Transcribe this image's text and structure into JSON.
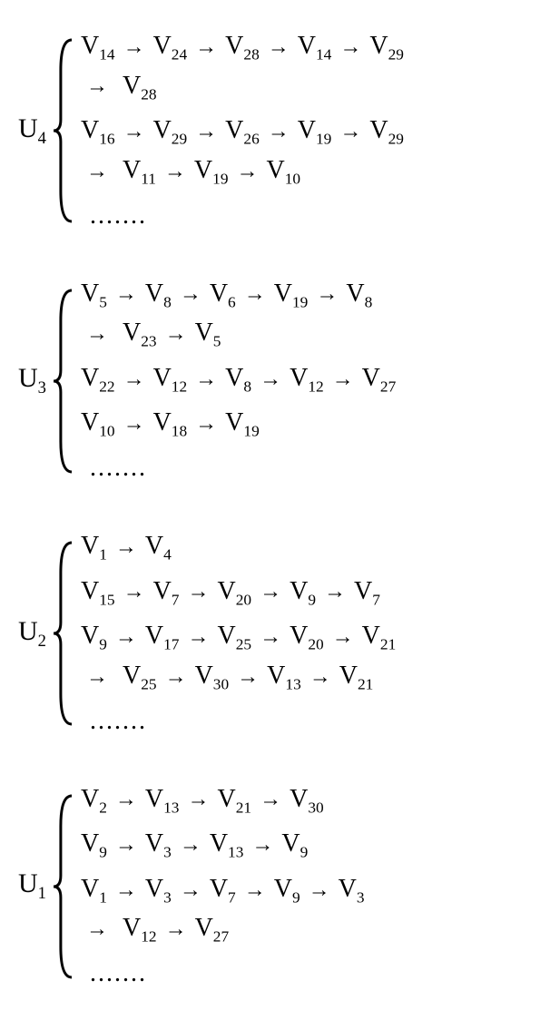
{
  "arrow": "→",
  "dots": ".......",
  "groups": [
    {
      "label_main": "U",
      "label_sub": "4",
      "rows": [
        {
          "indices": [
            14,
            24,
            28,
            14,
            29,
            28
          ],
          "break_after": 5
        },
        {
          "indices": [
            16,
            29,
            26,
            19,
            29,
            11,
            19,
            10
          ],
          "break_after": 5
        }
      ]
    },
    {
      "label_main": "U",
      "label_sub": "3",
      "rows": [
        {
          "indices": [
            5,
            8,
            6,
            19,
            8,
            23,
            5
          ],
          "break_after": 5
        },
        {
          "indices": [
            22,
            12,
            8,
            12,
            27
          ],
          "break_after": 99
        },
        {
          "indices": [
            10,
            18,
            19
          ],
          "break_after": 99
        }
      ]
    },
    {
      "label_main": "U",
      "label_sub": "2",
      "rows": [
        {
          "indices": [
            1,
            4
          ],
          "break_after": 99
        },
        {
          "indices": [
            15,
            7,
            20,
            9,
            7
          ],
          "break_after": 99
        },
        {
          "indices": [
            9,
            17,
            25,
            20,
            21,
            25,
            30,
            13,
            21
          ],
          "break_after": 5
        }
      ]
    },
    {
      "label_main": "U",
      "label_sub": "1",
      "rows": [
        {
          "indices": [
            2,
            13,
            21,
            30
          ],
          "break_after": 99
        },
        {
          "indices": [
            9,
            3,
            13,
            9
          ],
          "break_after": 99
        },
        {
          "indices": [
            1,
            3,
            7,
            9,
            3,
            12,
            27
          ],
          "break_after": 5
        }
      ]
    }
  ]
}
